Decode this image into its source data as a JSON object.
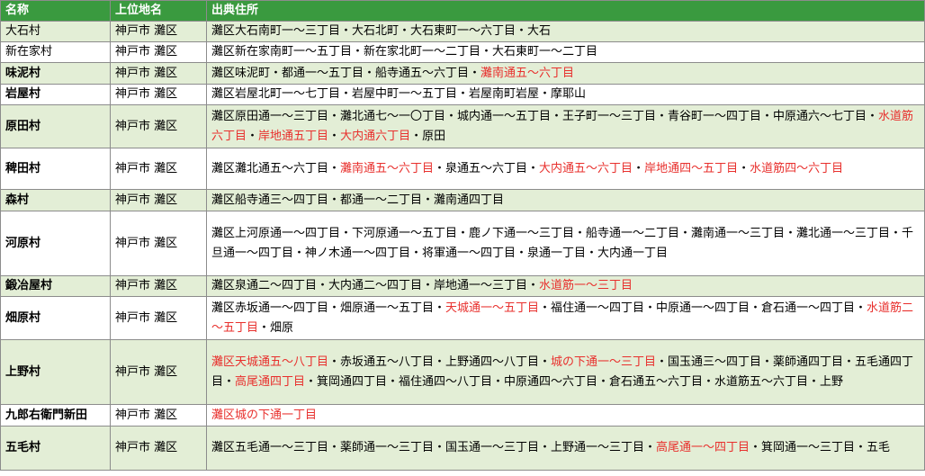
{
  "header": {
    "name": "名称",
    "parent": "上位地名",
    "source": "出典住所"
  },
  "rows": [
    {
      "name": "大石村",
      "bold": false,
      "parent": "神戸市 灘区",
      "h": 22,
      "addr": [
        {
          "t": "灘区大石南町一～三丁目・大石北町・大石東町一～六丁目・大石",
          "red": false
        }
      ]
    },
    {
      "name": "新在家村",
      "bold": false,
      "parent": "神戸市 灘区",
      "h": 22,
      "addr": [
        {
          "t": "灘区新在家南町一～五丁目・新在家北町一～二丁目・大石東町一～二丁目",
          "red": false
        }
      ]
    },
    {
      "name": "味泥村",
      "bold": true,
      "parent": "神戸市 灘区",
      "h": 24,
      "addr": [
        {
          "t": "灘区味泥町・都通一～五丁目・船寺通五～六丁目・",
          "red": false
        },
        {
          "t": "灘南通五～六丁目",
          "red": true
        }
      ]
    },
    {
      "name": "岩屋村",
      "bold": true,
      "parent": "神戸市 灘区",
      "h": 23,
      "addr": [
        {
          "t": "灘区岩屋北町一～七丁目・岩屋中町一～五丁目・岩屋南町岩屋・摩耶山",
          "red": false
        }
      ]
    },
    {
      "name": "原田村",
      "bold": true,
      "parent": "神戸市 灘区",
      "h": 48,
      "addr": [
        {
          "t": "灘区原田通一～三丁目・灘北通七～一〇丁目・城内通一～五丁目・王子町一～三丁目・青谷町一～四丁目・中原通六～七丁目・",
          "red": false
        },
        {
          "t": "水道筋六丁目",
          "red": true
        },
        {
          "t": "・",
          "red": false
        },
        {
          "t": "岸地通五丁目",
          "red": true
        },
        {
          "t": "・",
          "red": false
        },
        {
          "t": "大内通六丁目",
          "red": true
        },
        {
          "t": "・原田",
          "red": false
        }
      ]
    },
    {
      "name": "稗田村",
      "bold": true,
      "parent": "神戸市 灘区",
      "h": 46,
      "addr": [
        {
          "t": "灘区灘北通五～六丁目・",
          "red": false
        },
        {
          "t": "灘南通五～六丁目",
          "red": true
        },
        {
          "t": "・泉通五～六丁目・",
          "red": false
        },
        {
          "t": "大内通五～六丁目",
          "red": true
        },
        {
          "t": "・",
          "red": false
        },
        {
          "t": "岸地通四～五丁目",
          "red": true
        },
        {
          "t": "・",
          "red": false
        },
        {
          "t": "水道筋四～六丁目",
          "red": true
        }
      ]
    },
    {
      "name": "森村",
      "bold": true,
      "parent": "神戸市 灘区",
      "h": 24,
      "addr": [
        {
          "t": "灘区船寺通三～四丁目・都通一～二丁目・灘南通四丁目",
          "red": false
        }
      ]
    },
    {
      "name": "河原村",
      "bold": true,
      "parent": "神戸市 灘区",
      "h": 72,
      "addr": [
        {
          "t": "灘区上河原通一～四丁目・下河原通一～五丁目・鹿ノ下通一～三丁目・船寺通一～二丁目・灘南通一～三丁目・灘北通一～三丁目・千旦通一～四丁目・神ノ木通一～四丁目・将軍通一～四丁目・泉通一丁目・大内通一丁目",
          "red": false
        }
      ]
    },
    {
      "name": "鍛冶屋村",
      "bold": true,
      "parent": "神戸市 灘区",
      "h": 23,
      "addr": [
        {
          "t": "灘区泉通二～四丁目・大内通二～四丁目・岸地通一～三丁目・",
          "red": false
        },
        {
          "t": "水道筋一～三丁目",
          "red": true
        }
      ]
    },
    {
      "name": "畑原村",
      "bold": true,
      "parent": "神戸市 灘区",
      "h": 48,
      "addr": [
        {
          "t": "灘区赤坂通一～四丁目・畑原通一～五丁目・",
          "red": false
        },
        {
          "t": "天城通一～五丁目",
          "red": true
        },
        {
          "t": "・福住通一～四丁目・中原通一～四丁目・倉石通一～四丁目・",
          "red": false
        },
        {
          "t": "水道筋二～五丁目",
          "red": true
        },
        {
          "t": "・畑原",
          "red": false
        }
      ]
    },
    {
      "name": "上野村",
      "bold": true,
      "parent": "神戸市 灘区",
      "h": 72,
      "addr": [
        {
          "t": "灘区天城通五～八丁目",
          "red": true
        },
        {
          "t": "・赤坂通五～八丁目・上野通四～八丁目・",
          "red": false
        },
        {
          "t": "城の下通一～三丁目",
          "red": true
        },
        {
          "t": "・国玉通三～四丁目・薬師通四丁目・五毛通四丁目・",
          "red": false
        },
        {
          "t": "高尾通四丁目",
          "red": true
        },
        {
          "t": "・箕岡通四丁目・福住通四～八丁目・中原通四～六丁目・倉石通五～六丁目・水道筋五～六丁目・上野",
          "red": false
        }
      ]
    },
    {
      "name": "九郎右衛門新田",
      "bold": true,
      "parent": "神戸市 灘区",
      "h": 24,
      "addr": [
        {
          "t": "灘区城の下通一丁目",
          "red": true
        }
      ]
    },
    {
      "name": "五毛村",
      "bold": true,
      "parent": "神戸市 灘区",
      "h": 49,
      "addr": [
        {
          "t": "灘区五毛通一～三丁目・薬師通一～三丁目・国玉通一～三丁目・上野通一～三丁目・",
          "red": false
        },
        {
          "t": "高尾通一～四丁目",
          "red": true
        },
        {
          "t": "・箕岡通一～三丁目・五毛",
          "red": false
        }
      ]
    }
  ]
}
